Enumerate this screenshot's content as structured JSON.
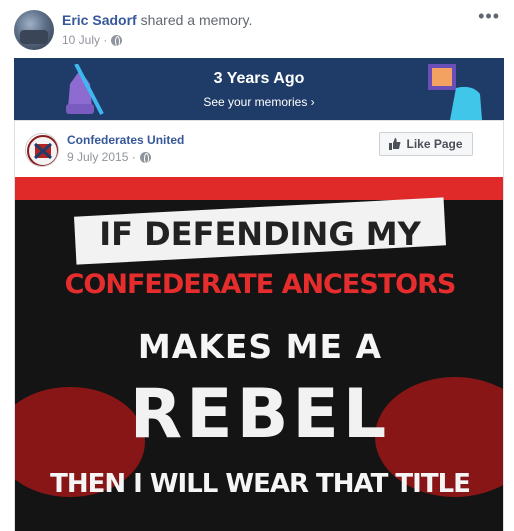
{
  "post": {
    "author_name": "Eric Sadorf",
    "action_text": " shared a memory.",
    "date": "10 July ·",
    "more_label": "•••"
  },
  "memories": {
    "title": "3 Years Ago",
    "subtitle": "See your memories ›"
  },
  "shared_post": {
    "page_name": "Confederates United",
    "date": "9 July 2015 ·",
    "like_page_label": "Like Page"
  },
  "image_text": {
    "line1": "IF DEFENDING MY",
    "line2": "CONFEDERATE ANCESTORS",
    "line3": "MAKES ME A",
    "line4": "REBEL",
    "line5": "THEN I WILL WEAR THAT TITLE"
  },
  "colors": {
    "name_link": "#365899",
    "memories_bg": "#1f3c68",
    "shirt_red": "#e62d2d"
  },
  "icons": [
    "globe-icon",
    "more-options-icon",
    "thumbs-up-icon",
    "balloon-illustration",
    "photo-illustration",
    "page-logo"
  ]
}
